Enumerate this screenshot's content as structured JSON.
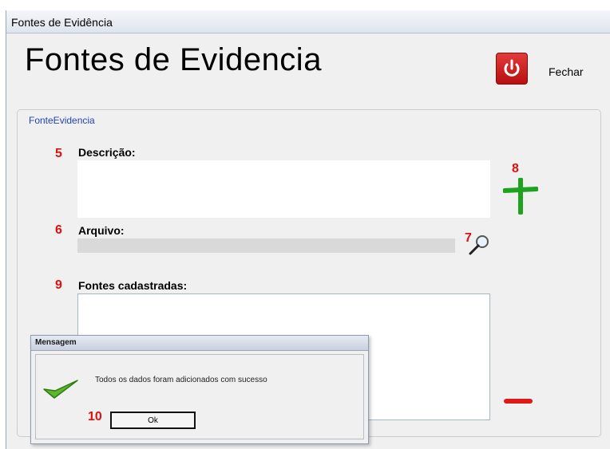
{
  "window": {
    "title": "Fontes de Evidência"
  },
  "header": {
    "title": "Fontes de Evidencia",
    "close_label": "Fechar"
  },
  "group": {
    "legend": "FonteEvidencia"
  },
  "annotations": {
    "n5": "5",
    "n6": "6",
    "n7": "7",
    "n8": "8",
    "n9": "9",
    "n10": "10"
  },
  "form": {
    "description_label": "Descrição:",
    "description_value": "",
    "file_label": "Arquivo:",
    "file_value": "",
    "registered_label": "Fontes cadastradas:"
  },
  "dialog": {
    "title": "Mensagem",
    "message": "Todos os dados foram adicionados com sucesso",
    "ok_label": "Ok"
  },
  "colors": {
    "annotation": "#e01010",
    "add": "#1fa31f",
    "remove": "#e01818",
    "close_button": "#c81a1a"
  },
  "icons": [
    "power-icon",
    "magnifier-icon",
    "plus-icon",
    "minus-icon",
    "check-icon"
  ]
}
